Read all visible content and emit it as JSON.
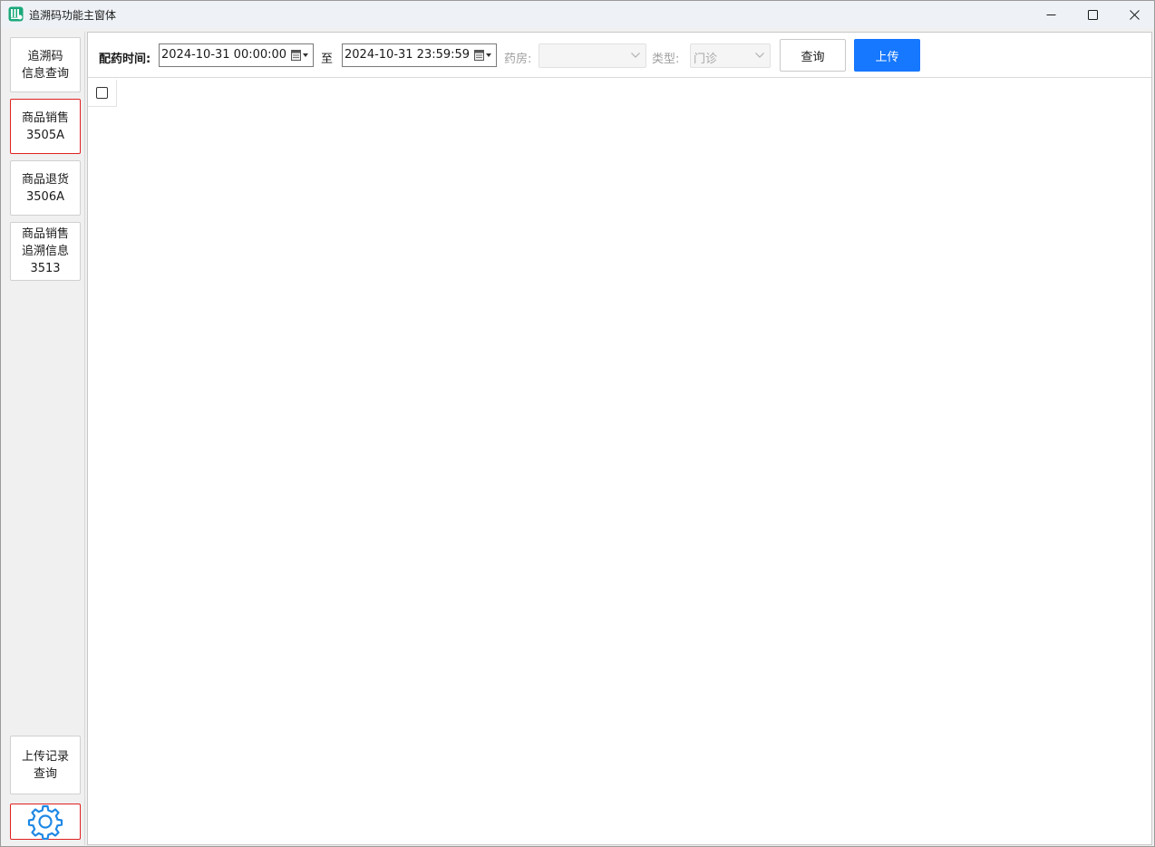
{
  "window": {
    "title": "追溯码功能主窗体",
    "icon": "app-logo-icon"
  },
  "sidebar": {
    "items": [
      {
        "label": "追溯码\n信息查询",
        "active": false
      },
      {
        "label": "商品销售\n3505A",
        "active": true
      },
      {
        "label": "商品退货\n3506A",
        "active": false
      },
      {
        "label": "商品销售\n追溯信息\n3513",
        "active": false
      }
    ],
    "upload_record": "上传记录\n查询",
    "settings_icon": "gear-icon"
  },
  "toolbar": {
    "dispense_time_label": "配药时间:",
    "start_time": "2024-10-31 00:00:00",
    "to_label": "至",
    "end_time": "2024-10-31 23:59:59",
    "pharmacy_label": "药房:",
    "pharmacy_value": "",
    "type_label": "类型:",
    "type_value": "门诊",
    "query_label": "查询",
    "upload_label": "上传"
  },
  "colors": {
    "accent": "#1677ff",
    "active_border": "#e02020",
    "gear": "#1e88e5"
  }
}
